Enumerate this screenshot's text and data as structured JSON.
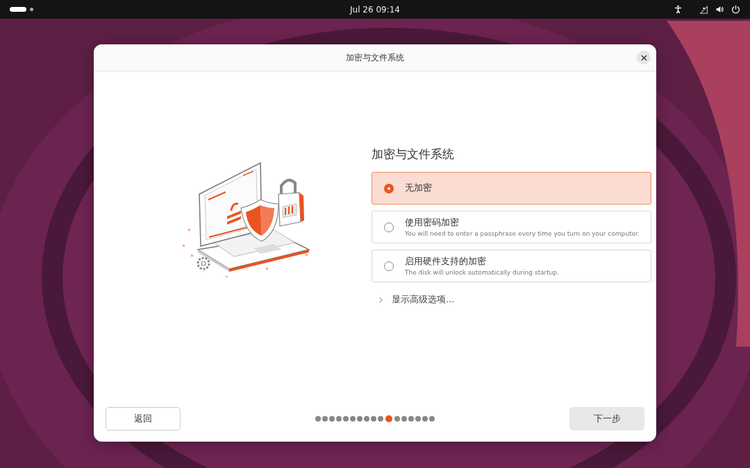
{
  "top_bar": {
    "clock": "Jul 26  09:14"
  },
  "window": {
    "title": "加密与文件系统"
  },
  "heading": "加密与文件系统",
  "options": [
    {
      "label": "无加密",
      "selected": true
    },
    {
      "label": "使用密码加密",
      "description": "You will need to enter a passphrase every time you turn on your computer.",
      "selected": false
    },
    {
      "label": "启用硬件支持的加密",
      "description": "The disk will unlock automatically during startup.",
      "selected": false
    }
  ],
  "advanced": {
    "label": "显示高级选项…",
    "expanded": false
  },
  "back_button": "返回",
  "next_button": "下一步",
  "progress_dots": [
    {
      "selected": false
    },
    {
      "selected": false
    },
    {
      "selected": false
    },
    {
      "selected": false
    },
    {
      "selected": false
    },
    {
      "selected": false
    },
    {
      "selected": false
    },
    {
      "selected": false
    },
    {
      "selected": false
    },
    {
      "selected": false
    },
    {
      "selected": true
    },
    {
      "selected": false
    },
    {
      "selected": false
    },
    {
      "selected": false
    },
    {
      "selected": false
    },
    {
      "selected": false
    },
    {
      "selected": false
    }
  ]
}
